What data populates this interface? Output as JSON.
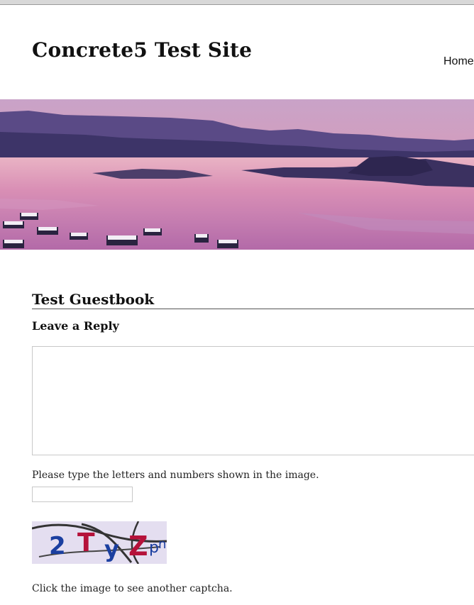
{
  "site": {
    "title": "Concrete5 Test Site"
  },
  "nav": {
    "home_label": "Home"
  },
  "page": {
    "title": "Test Guestbook",
    "reply_heading": "Leave a Reply"
  },
  "form": {
    "comment_value": "",
    "captcha_instructions": "Please type the letters and numbers shown in the image.",
    "captcha_value": "",
    "captcha_text": "2TyZpn",
    "captcha_hint": "Click the image to see another captcha."
  },
  "colors": {
    "captcha_blue": "#1b3fa0",
    "captcha_red": "#b5123a",
    "captcha_bg": "#e4def0"
  }
}
